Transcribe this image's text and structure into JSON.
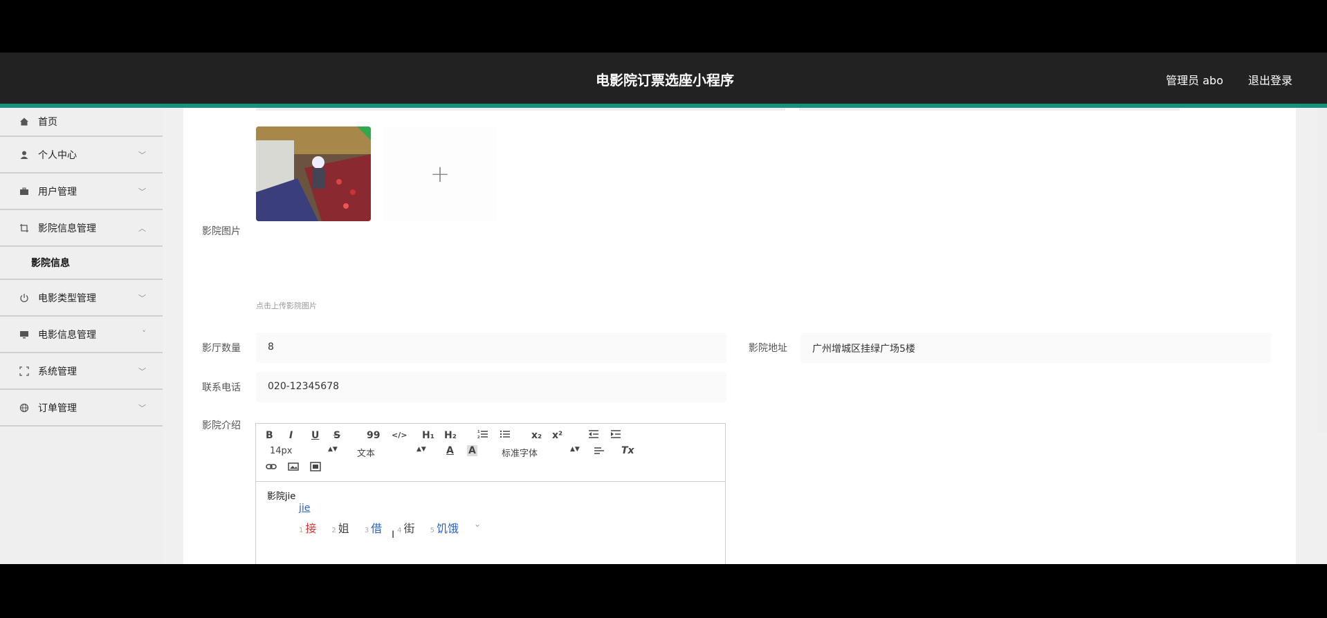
{
  "header": {
    "title": "电影院订票选座小程序",
    "user": "管理员 abo",
    "logout": "退出登录"
  },
  "sidebar": {
    "items": [
      {
        "label": "首页",
        "icon": "home-icon"
      },
      {
        "label": "个人中心",
        "icon": "user-icon"
      },
      {
        "label": "用户管理",
        "icon": "briefcase-icon"
      },
      {
        "label": "影院信息管理",
        "icon": "crop-icon"
      },
      {
        "label": "电影类型管理",
        "icon": "power-icon"
      },
      {
        "label": "电影信息管理",
        "icon": "monitor-icon"
      },
      {
        "label": "系统管理",
        "icon": "expand-icon"
      },
      {
        "label": "订单管理",
        "icon": "globe-icon"
      }
    ],
    "sub_item": "影院信息"
  },
  "form": {
    "image_label": "影院图片",
    "image_hint": "点击上传影院图片",
    "halls_label": "影厅数量",
    "halls_value": "8",
    "address_label": "影院地址",
    "address_value": "广州增城区挂绿广场5楼",
    "phone_label": "联系电话",
    "phone_value": "020-12345678",
    "intro_label": "影院介绍"
  },
  "editor": {
    "toolbar": {
      "bold": "B",
      "italic": "I",
      "underline": "U",
      "strike": "S",
      "quote": "99",
      "code": "</>",
      "h1": "H₁",
      "h2": "H₂",
      "sub": "x₂",
      "sup": "x²",
      "size": "14px",
      "header": "文本",
      "font": "标准字体",
      "clear": "Tx"
    },
    "content": "影院jie",
    "ime": {
      "composition": "jie",
      "candidates": [
        {
          "num": "1",
          "text": "接"
        },
        {
          "num": "2",
          "text": "姐"
        },
        {
          "num": "3",
          "text": "借"
        },
        {
          "num": "4",
          "text": "街"
        },
        {
          "num": "5",
          "text": "饥饿"
        }
      ]
    }
  }
}
